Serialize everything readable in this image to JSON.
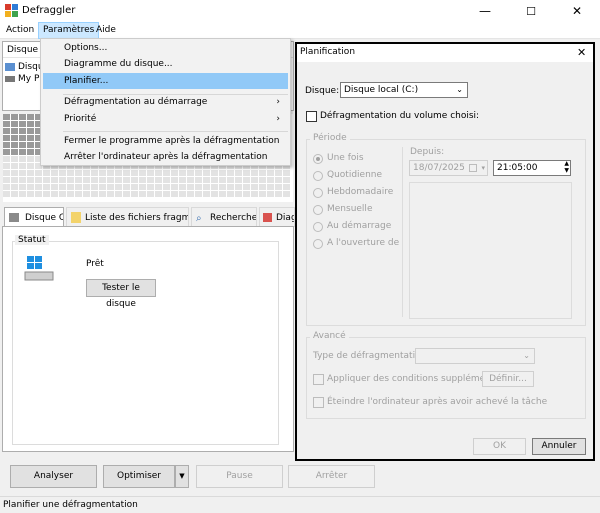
{
  "app": {
    "title": "Defraggler"
  },
  "window_controls": {
    "minimize": "—",
    "maximize": "☐",
    "close": "✕"
  },
  "menu": [
    "Action",
    "Paramètres",
    "Aide"
  ],
  "drive_list": {
    "col_header": "Disque",
    "rows": [
      "Disqu",
      "My P"
    ]
  },
  "tabs": [
    "Disque C:",
    "Liste des fichiers fragmentés",
    "Recherche",
    "Diagr"
  ],
  "status_panel": {
    "group_label": "Statut",
    "state": "Prêt",
    "test_button": "Tester le disque"
  },
  "buttons": {
    "analyze": "Analyser",
    "optimize": "Optimiser",
    "pause": "Pause",
    "stop": "Arrêter"
  },
  "statusbar": "Planifier une défragmentation",
  "params_menu": {
    "items": [
      "Options...",
      "Diagramme du disque...",
      "Planifier...",
      "Défragmentation au démarrage",
      "Priorité",
      "Fermer le programme après la défragmentation",
      "Arrêter l'ordinateur après la défragmentation"
    ],
    "submenu_arrow": "›"
  },
  "dialog": {
    "title": "Planification",
    "close": "✕",
    "disk_label": "Disque:",
    "disk_value": "Disque local (C:)",
    "defrag_checkbox": "Défragmentation du volume choisi:",
    "period_group": "Période",
    "periods": [
      "Une fois",
      "Quotidienne",
      "Hebdomadaire",
      "Mensuelle",
      "Au démarrage",
      "A l'ouverture de sess"
    ],
    "since_label": "Depuis:",
    "date": "18/07/2025",
    "time": "21:05:00",
    "advanced_group": "Avancé",
    "defrag_type_label": "Type de défragmentation:",
    "extra_conditions": "Appliquer des conditions supplémentaires:",
    "define_button": "Définir...",
    "shutdown_checkbox": "Éteindre l'ordinateur après avoir achevé la tâche",
    "ok": "OK",
    "cancel": "Annuler"
  },
  "colors": {
    "menu_highlight": "#91c9f7",
    "active_menu": "#cce8ff",
    "block": "#9a9a9a"
  }
}
